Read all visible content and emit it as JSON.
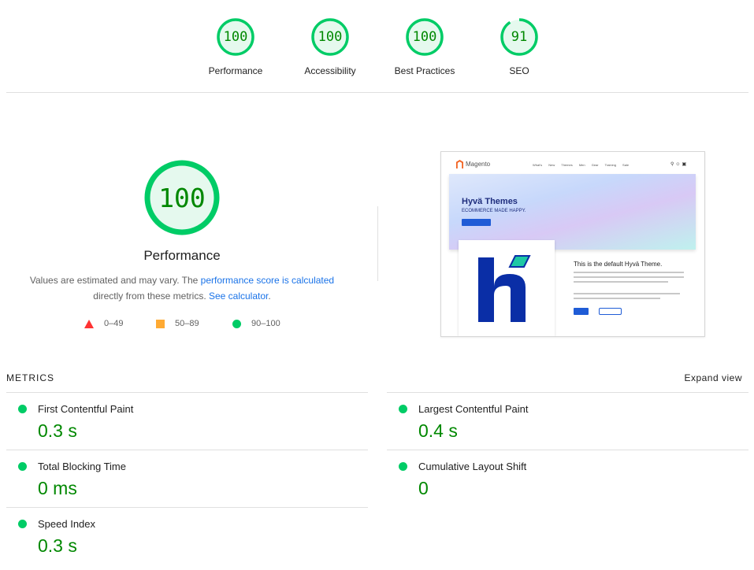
{
  "categories": [
    {
      "score": "100",
      "label": "Performance",
      "fraction": 1.0
    },
    {
      "score": "100",
      "label": "Accessibility",
      "fraction": 1.0
    },
    {
      "score": "100",
      "label": "Best Practices",
      "fraction": 1.0
    },
    {
      "score": "91",
      "label": "SEO",
      "fraction": 0.91
    }
  ],
  "performance": {
    "score": "100",
    "title": "Performance",
    "desc_prefix": "Values are estimated and may vary. The ",
    "desc_link1": "performance score is calculated",
    "desc_mid": " directly from these metrics. ",
    "desc_link2": "See calculator",
    "desc_suffix": "."
  },
  "legend": [
    {
      "shape": "triangle",
      "range": "0–49",
      "color": "#ff3333"
    },
    {
      "shape": "square",
      "range": "50–89",
      "color": "#ffaa33"
    },
    {
      "shape": "circle",
      "range": "90–100",
      "color": "#00cc66"
    }
  ],
  "screenshot": {
    "brand": "Magento",
    "nav_links": "What's New Themes Men Gear Training Sale",
    "hero_title": "Hyvä Themes",
    "hero_subtitle": "ECOMMERCE MADE HAPPY.",
    "welcome": "This is the default Hyvä Theme."
  },
  "metrics": {
    "heading": "METRICS",
    "expand": "Expand view",
    "items": [
      {
        "name": "First Contentful Paint",
        "value": "0.3 s"
      },
      {
        "name": "Largest Contentful Paint",
        "value": "0.4 s"
      },
      {
        "name": "Total Blocking Time",
        "value": "0 ms"
      },
      {
        "name": "Cumulative Layout Shift",
        "value": "0"
      },
      {
        "name": "Speed Index",
        "value": "0.3 s"
      }
    ]
  },
  "colors": {
    "pass": "#00cc66",
    "pass_text": "#008800",
    "link": "#1a73e8"
  }
}
